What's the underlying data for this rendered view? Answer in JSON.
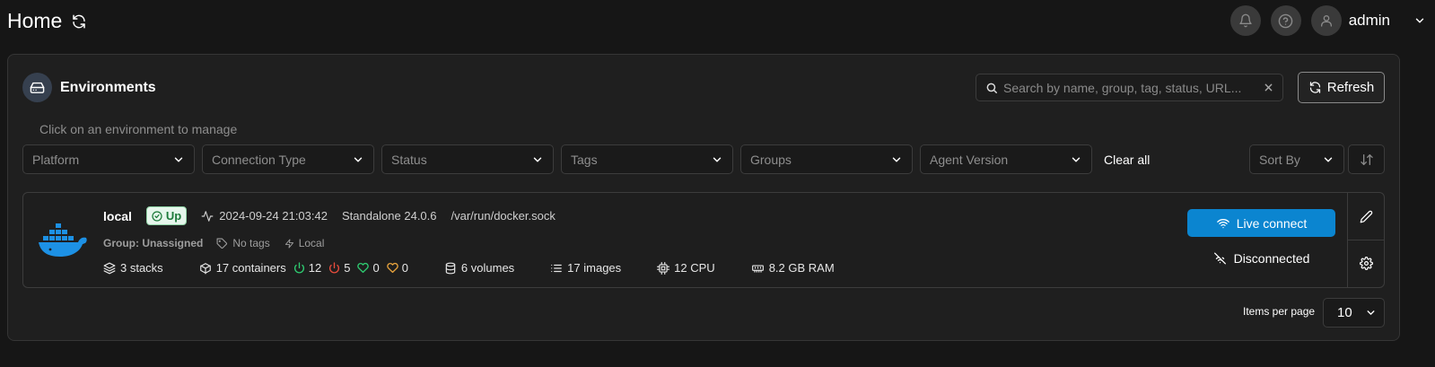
{
  "header": {
    "title": "Home",
    "user_name": "admin"
  },
  "environments": {
    "title": "Environments",
    "subtitle": "Click on an environment to manage",
    "search_placeholder": "Search by name, group, tag, status, URL...",
    "refresh_label": "Refresh",
    "filters": [
      {
        "label": "Platform"
      },
      {
        "label": "Connection Type"
      },
      {
        "label": "Status"
      },
      {
        "label": "Tags"
      },
      {
        "label": "Groups"
      },
      {
        "label": "Agent Version"
      }
    ],
    "clear_all_label": "Clear all",
    "sort_by_label": "Sort By"
  },
  "environment": {
    "name": "local",
    "status": "Up",
    "timestamp": "2024-09-24 21:03:42",
    "edition": "Standalone 24.0.6",
    "url": "/var/run/docker.sock",
    "group": "Group: Unassigned",
    "tags": "No tags",
    "type": "Local",
    "stacks": "3 stacks",
    "containers": "17 containers",
    "running": "12",
    "stopped": "5",
    "healthy": "0",
    "unhealthy": "0",
    "volumes": "6 volumes",
    "images": "17 images",
    "cpu": "12 CPU",
    "ram": "8.2 GB RAM",
    "live_connect_label": "Live connect",
    "connection_status": "Disconnected"
  },
  "pagination": {
    "items_per_page_label": "Items per page",
    "page_size": "10"
  },
  "colors": {
    "accent": "#0b85d0",
    "running": "#2ecc71",
    "stopped": "#e74c3c",
    "healthy": "#2ecc71",
    "unhealthy": "#e8a33d",
    "docker": "#1d91e5"
  }
}
